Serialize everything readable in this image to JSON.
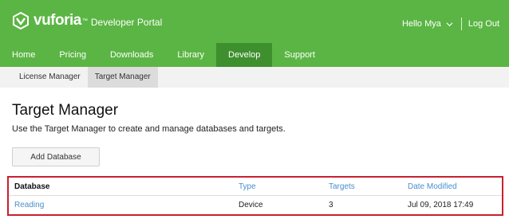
{
  "brand": {
    "name": "vuforia",
    "tm": "™",
    "subtitle": "Developer Portal",
    "header_color": "#5bb544",
    "active_nav_color": "#3e8f2d",
    "link_color": "#4a8fcb",
    "highlight_color": "#c8202f"
  },
  "user": {
    "greeting": "Hello Mya",
    "logout_label": "Log Out"
  },
  "main_nav": [
    {
      "label": "Home"
    },
    {
      "label": "Pricing"
    },
    {
      "label": "Downloads"
    },
    {
      "label": "Library"
    },
    {
      "label": "Develop",
      "active": true
    },
    {
      "label": "Support"
    }
  ],
  "sub_nav": [
    {
      "label": "License Manager"
    },
    {
      "label": "Target Manager",
      "active": true
    }
  ],
  "page": {
    "title": "Target Manager",
    "description": "Use the Target Manager to create and manage databases and targets.",
    "add_button_label": "Add Database"
  },
  "table": {
    "columns": [
      "Database",
      "Type",
      "Targets",
      "Date Modified"
    ],
    "rows": [
      {
        "database": "Reading",
        "type": "Device",
        "targets": "3",
        "date_modified": "Jul 09, 2018 17:49"
      }
    ]
  }
}
